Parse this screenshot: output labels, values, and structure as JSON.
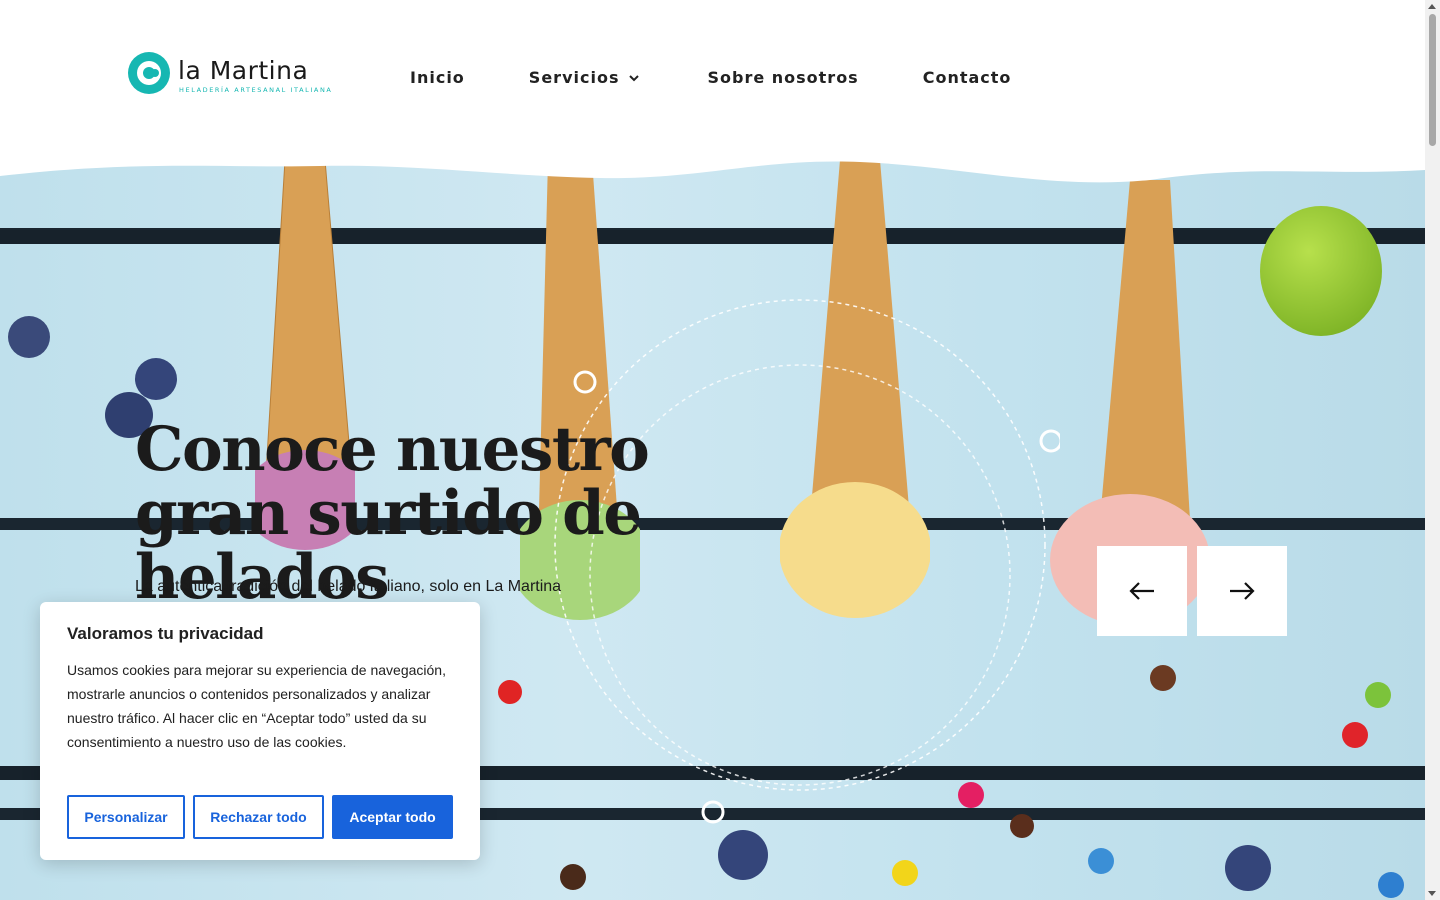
{
  "brand": {
    "name": "la Martina",
    "tagline": "HELADERÍA ARTESANAL ITALIANA",
    "accent_color": "#16b7b2"
  },
  "nav": {
    "items": [
      {
        "label": "Inicio"
      },
      {
        "label": "Servicios",
        "icon": "chevron-down-icon"
      },
      {
        "label": "Sobre nosotros"
      },
      {
        "label": "Contacto"
      }
    ]
  },
  "hero": {
    "title": "Conoce nuestro gran surtido de helados",
    "subtitle": "La auténtica tradición del helado italiano, solo en La Martina",
    "prev_icon": "arrow-left-icon",
    "next_icon": "arrow-right-icon"
  },
  "cookie": {
    "title": "Valoramos tu privacidad",
    "body": "Usamos cookies para mejorar su experiencia de navegación, mostrarle anuncios o contenidos personalizados y analizar nuestro tráfico. Al hacer clic en “Aceptar todo” usted da su consentimiento a nuestro uso de las cookies.",
    "customize_label": "Personalizar",
    "reject_label": "Rechazar todo",
    "accept_label": "Aceptar todo",
    "button_color": "#1863dc"
  }
}
